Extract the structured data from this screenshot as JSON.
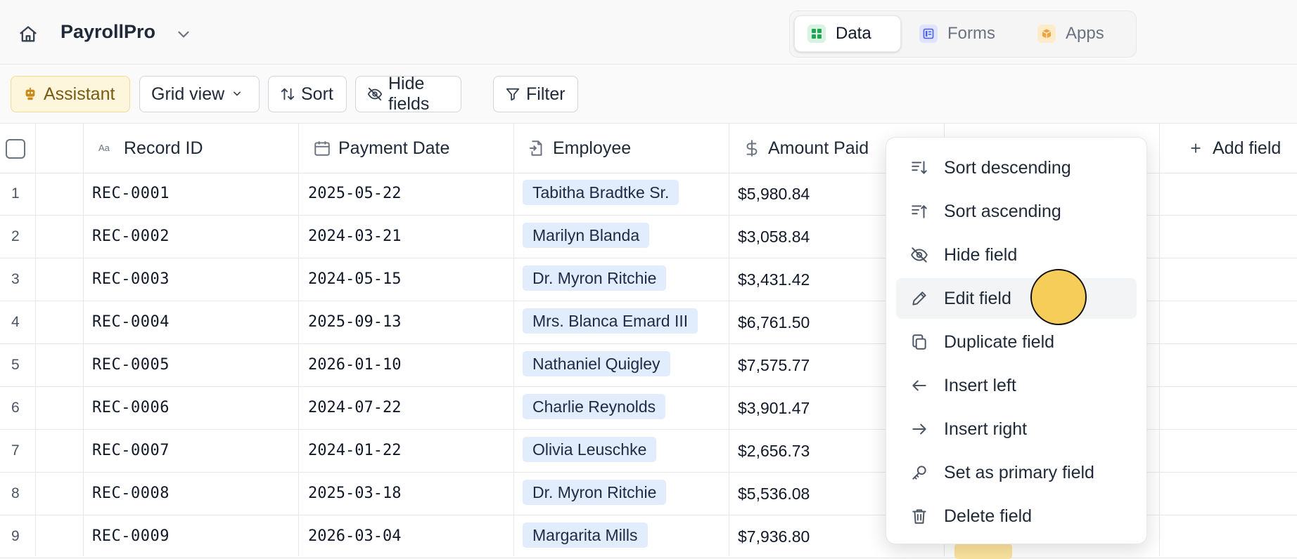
{
  "app": {
    "title": "PayrollPro"
  },
  "switcher": {
    "tabs": [
      {
        "label": "Data",
        "active": true,
        "icon": "grid-icon",
        "color": "#22a653"
      },
      {
        "label": "Forms",
        "active": false,
        "icon": "form-icon",
        "color": "#4c5fe6"
      },
      {
        "label": "Apps",
        "active": false,
        "icon": "box-icon",
        "color": "#f0a33a"
      }
    ]
  },
  "toolbar": {
    "assistant": "Assistant",
    "view": "Grid view",
    "sort": "Sort",
    "hide_fields": "Hide fields",
    "filter": "Filter"
  },
  "columns": {
    "record_id": "Record ID",
    "payment_date": "Payment Date",
    "employee": "Employee",
    "amount_paid": "Amount Paid",
    "add_field": "Add field"
  },
  "rows": [
    {
      "num": "1",
      "id": "REC-0001",
      "date": "2025-05-22",
      "employee": "Tabitha Bradtke Sr.",
      "amount": "$5,980.84"
    },
    {
      "num": "2",
      "id": "REC-0002",
      "date": "2024-03-21",
      "employee": "Marilyn Blanda",
      "amount": "$3,058.84"
    },
    {
      "num": "3",
      "id": "REC-0003",
      "date": "2024-05-15",
      "employee": "Dr. Myron Ritchie",
      "amount": "$3,431.42"
    },
    {
      "num": "4",
      "id": "REC-0004",
      "date": "2025-09-13",
      "employee": "Mrs. Blanca Emard III",
      "amount": "$6,761.50"
    },
    {
      "num": "5",
      "id": "REC-0005",
      "date": "2026-01-10",
      "employee": "Nathaniel Quigley",
      "amount": "$7,575.77"
    },
    {
      "num": "6",
      "id": "REC-0006",
      "date": "2024-07-22",
      "employee": "Charlie Reynolds",
      "amount": "$3,901.47"
    },
    {
      "num": "7",
      "id": "REC-0007",
      "date": "2024-01-22",
      "employee": "Olivia Leuschke",
      "amount": "$2,656.73"
    },
    {
      "num": "8",
      "id": "REC-0008",
      "date": "2025-03-18",
      "employee": "Dr. Myron Ritchie",
      "amount": "$5,536.08"
    },
    {
      "num": "9",
      "id": "REC-0009",
      "date": "2026-03-04",
      "employee": "Margarita Mills",
      "amount": "$7,936.80"
    }
  ],
  "menu": {
    "items": [
      {
        "label": "Sort descending",
        "icon": "sort-descending-icon"
      },
      {
        "label": "Sort ascending",
        "icon": "sort-ascending-icon"
      },
      {
        "label": "Hide field",
        "icon": "eye-off-icon"
      },
      {
        "label": "Edit field",
        "icon": "pencil-icon",
        "hovered": true
      },
      {
        "label": "Duplicate field",
        "icon": "copy-icon"
      },
      {
        "label": "Insert left",
        "icon": "arrow-left-icon"
      },
      {
        "label": "Insert right",
        "icon": "arrow-right-icon"
      },
      {
        "label": "Set as primary field",
        "icon": "key-icon"
      },
      {
        "label": "Delete field",
        "icon": "trash-icon"
      }
    ]
  },
  "colors": {
    "accent": "#f7cd59",
    "employee_chip": "#e1ecfd",
    "assistant_bg": "#fdf6dc"
  }
}
